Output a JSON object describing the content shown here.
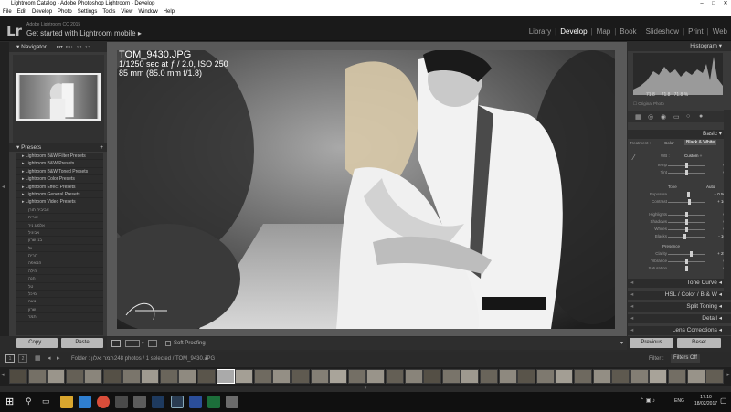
{
  "window": {
    "title": "Lightroom Catalog - Adobe Photoshop Lightroom - Develop",
    "menu": [
      "File",
      "Edit",
      "Develop",
      "Photo",
      "Settings",
      "Tools",
      "View",
      "Window",
      "Help"
    ]
  },
  "identity": {
    "logo": "Lr",
    "product": "Adobe Lightroom CC 2015",
    "tagline": "Get started with Lightroom mobile",
    "arrow": "▸"
  },
  "modules": [
    "Library",
    "Develop",
    "Map",
    "Book",
    "Slideshow",
    "Print",
    "Web"
  ],
  "active_module": "Develop",
  "navigator": {
    "title": "Navigator",
    "zoom": [
      "FIT",
      "FILL",
      "1:1",
      "1:2"
    ]
  },
  "presets": {
    "title": "Presets",
    "add": "+",
    "items": [
      "Lightroom B&W Filter Presets",
      "Lightroom B&W Presets",
      "Lightroom B&W Toned Presets",
      "Lightroom Color Presets",
      "Lightroom Effect Presets",
      "Lightroom General Presets",
      "Lightroom Video Presets"
    ],
    "sub_items": [
      "אביבית תורן",
      "אורית",
      "אלמוג ניר",
      "אביגיל",
      "בני שרון",
      "גל",
      "דורית",
      "המאפה",
      "הילה",
      "חנה",
      "טל",
      "מיכל",
      "נועה",
      "שרון",
      "תמר"
    ]
  },
  "left_buttons": {
    "copy": "Copy...",
    "paste": "Paste"
  },
  "photo": {
    "filename": "TOM_9430.JPG",
    "exposure": "1/1250 sec at ƒ / 2.0, ISO 250",
    "lens": "85 mm (85.0 mm f/1.8)"
  },
  "toolbar": {
    "soft_proofing": "Soft Proofing"
  },
  "histogram": {
    "title": "Histogram",
    "readout": [
      "71.8",
      "71.8",
      "71.8 %"
    ],
    "original_photo": "Original Photo"
  },
  "basic": {
    "title": "Basic",
    "treatment_label": "Treatment :",
    "color": "Color",
    "bw": "Black & White",
    "wb_label": "WB :",
    "wb_value": "Custom ÷",
    "tone_label": "Tone",
    "auto": "Auto",
    "presence_label": "Presence",
    "sliders": [
      {
        "name": "Temp",
        "value": "0",
        "pos": 0.5
      },
      {
        "name": "Tint",
        "value": "0",
        "pos": 0.5
      },
      {
        "name": "Exposure",
        "value": "+ 0.50",
        "pos": 0.56
      },
      {
        "name": "Contrast",
        "value": "+ 16",
        "pos": 0.58
      },
      {
        "name": "Highlights",
        "value": "0",
        "pos": 0.5
      },
      {
        "name": "Shadows",
        "value": "0",
        "pos": 0.5
      },
      {
        "name": "Whites",
        "value": "0",
        "pos": 0.5
      },
      {
        "name": "Blacks",
        "value": "- 10",
        "pos": 0.45
      },
      {
        "name": "Clarity",
        "value": "+ 25",
        "pos": 0.62
      },
      {
        "name": "Vibrance",
        "value": "0",
        "pos": 0.5
      },
      {
        "name": "Saturation",
        "value": "0",
        "pos": 0.5
      }
    ]
  },
  "right_sections": [
    {
      "title": "Tone Curve"
    },
    {
      "title": "HSL / Color / B & W"
    },
    {
      "title": "Split Toning"
    },
    {
      "title": "Detail"
    },
    {
      "title": "Lens Corrections"
    }
  ],
  "right_buttons": {
    "previous": "Previous",
    "reset": "Reset"
  },
  "filmstrip": {
    "pages": [
      "1",
      "2"
    ],
    "folder_label": "Folder : ",
    "folder_name": "תמר ואלון",
    "count": "248 photos / 1 selected / TOM_9430.JPG",
    "filter_label": "Filter :",
    "filter_value": "Filters Off",
    "thumbnail_count": 38,
    "selected_index": 11
  },
  "taskbar": {
    "time": "17:10",
    "date": "18/02/2017",
    "lang": "ENG"
  },
  "colors": {
    "accent": "#ffffff",
    "panel": "#3a3a3a",
    "taskbar": "#101010"
  }
}
